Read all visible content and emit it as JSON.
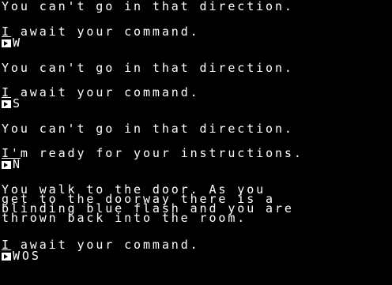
{
  "screen": {
    "lines": [
      "You can't go in that direction.",
      "I await your command.",
      "W",
      "You can't go in that direction.",
      "I await your command.",
      "S",
      "You can't go in that direction.",
      "I'm ready for your instructions.",
      "N",
      "You walk to the door. As you",
      "get to the doorway there is a",
      "blinding blue flash and you are",
      "thrown back into the room.",
      "I await your command.",
      "WOS"
    ]
  },
  "colors": {
    "background": "#000000",
    "text": "#ffffff"
  },
  "icons": {
    "prompt": "prompt-arrow-icon"
  }
}
